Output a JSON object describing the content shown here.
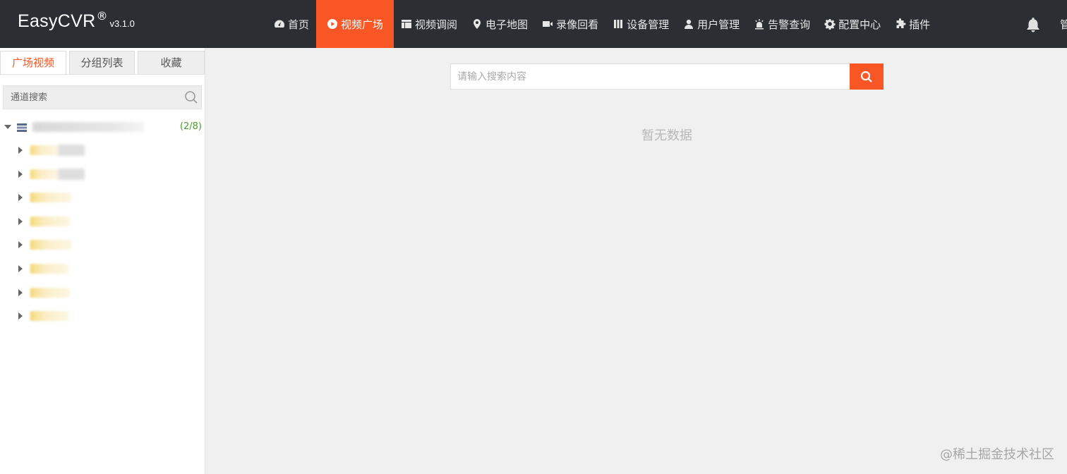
{
  "header": {
    "logo": {
      "name": "EasyCVR",
      "reg": "®",
      "version": "v3.1.0"
    },
    "nav": [
      {
        "label": "首页",
        "icon": "dashboard-icon",
        "active": false
      },
      {
        "label": "视频广场",
        "icon": "play-circle-icon",
        "active": true
      },
      {
        "label": "视频调阅",
        "icon": "layout-icon",
        "active": false
      },
      {
        "label": "电子地图",
        "icon": "map-pin-icon",
        "active": false
      },
      {
        "label": "录像回看",
        "icon": "video-camera-icon",
        "active": false
      },
      {
        "label": "设备管理",
        "icon": "device-icon",
        "active": false
      },
      {
        "label": "用户管理",
        "icon": "user-icon",
        "active": false
      },
      {
        "label": "告警查询",
        "icon": "alarm-light-icon",
        "active": false
      },
      {
        "label": "配置中心",
        "icon": "gear-icon",
        "active": false
      },
      {
        "label": "插件",
        "icon": "puzzle-icon",
        "active": false
      }
    ],
    "bell_icon": "bell-icon",
    "cut_text": "管"
  },
  "sidebar": {
    "tabs": [
      {
        "label": "广场视频",
        "active": true
      },
      {
        "label": "分组列表",
        "active": false
      },
      {
        "label": "收藏",
        "active": false
      }
    ],
    "search": {
      "placeholder": "通道搜索",
      "value": ""
    },
    "tree": {
      "root": {
        "count": "(2/8)"
      },
      "children_count": 8
    }
  },
  "main": {
    "search": {
      "placeholder": "请输入搜索内容",
      "value": ""
    },
    "empty_text": "暂无数据"
  },
  "watermark": "@稀土掘金技术社区",
  "colors": {
    "accent": "#f95625",
    "header_bg": "#2b2e33",
    "count_green": "#4c9a2a"
  }
}
